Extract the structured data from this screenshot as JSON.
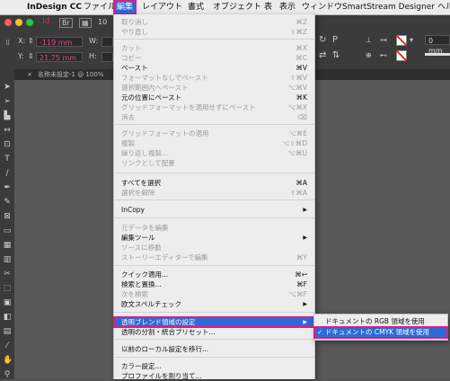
{
  "menubar": {
    "apple": "",
    "app": "InDesign CC",
    "items": [
      "ファイル",
      "編集",
      "レイアウト",
      "書式",
      "オブジェクト",
      "表",
      "表示",
      "ウィンドウ",
      "SmartStream Designer",
      "ヘル"
    ]
  },
  "toolbar": {
    "x_label": "X:",
    "x_value": "-119 mm",
    "y_label": "Y:",
    "y_value": "21.75 mm",
    "w_label": "W:",
    "h_label": "H:",
    "zoom_partial": "10",
    "stroke_value": "0 mm"
  },
  "document_tab": {
    "title": "名称未設定-1 @ 100%"
  },
  "edit_menu": {
    "items": [
      {
        "label": "取り消し",
        "shortcut": "⌘Z",
        "disabled": true
      },
      {
        "label": "やり直し",
        "shortcut": "⇧⌘Z",
        "disabled": true
      },
      {
        "label": "カット",
        "shortcut": "⌘X",
        "disabled": true
      },
      {
        "label": "コピー",
        "shortcut": "⌘C",
        "disabled": true
      },
      {
        "label": "ペースト",
        "shortcut": "⌘V",
        "disabled": false
      },
      {
        "label": "フォーマットなしでペースト",
        "shortcut": "⇧⌘V",
        "disabled": true
      },
      {
        "label": "選択範囲内へペースト",
        "shortcut": "⌥⌘V",
        "disabled": true
      },
      {
        "label": "元の位置にペースト",
        "shortcut": "⌘K",
        "disabled": false
      },
      {
        "label": "グリッドフォーマットを適用せずにペースト",
        "shortcut": "⌥⌘X",
        "disabled": true
      },
      {
        "label": "消去",
        "shortcut": "⌫",
        "disabled": true
      },
      {
        "label": "グリッドフォーマットの適用",
        "shortcut": "⌥⌘E",
        "disabled": true
      },
      {
        "label": "複製",
        "shortcut": "⌥⇧⌘D",
        "disabled": true
      },
      {
        "label": "繰り返し複製...",
        "shortcut": "⌥⌘U",
        "disabled": true
      },
      {
        "label": "リンクとして配置",
        "shortcut": "",
        "disabled": true
      },
      {
        "label": "すべてを選択",
        "shortcut": "⌘A",
        "disabled": false
      },
      {
        "label": "選択を解除",
        "shortcut": "⇧⌘A",
        "disabled": true
      },
      {
        "label": "InCopy",
        "shortcut": "",
        "disabled": false
      },
      {
        "label": "元データを編集",
        "shortcut": "",
        "disabled": true
      },
      {
        "label": "編集ツール",
        "shortcut": "",
        "disabled": false
      },
      {
        "label": "ソースに移動",
        "shortcut": "",
        "disabled": true
      },
      {
        "label": "ストーリーエディターで編集",
        "shortcut": "⌘Y",
        "disabled": true
      },
      {
        "label": "クイック適用...",
        "shortcut": "⌘↩",
        "disabled": false
      },
      {
        "label": "検索と置換...",
        "shortcut": "⌘F",
        "disabled": false
      },
      {
        "label": "次を検索",
        "shortcut": "⌥⌘F",
        "disabled": true
      },
      {
        "label": "欧文スペルチェック",
        "shortcut": "",
        "disabled": false
      },
      {
        "label": "透明ブレンド領域の設定",
        "shortcut": "",
        "disabled": false
      },
      {
        "label": "透明の分割・統合プリセット...",
        "shortcut": "",
        "disabled": false
      },
      {
        "label": "以前のローカル設定を移行...",
        "shortcut": "",
        "disabled": false
      },
      {
        "label": "カラー設定...",
        "shortcut": "",
        "disabled": false
      },
      {
        "label": "プロファイルを割り当て...",
        "shortcut": "",
        "disabled": false
      }
    ]
  },
  "submenu": {
    "items": [
      {
        "label": "ドキュメントの RGB 領域を使用",
        "checked": false
      },
      {
        "label": "ドキュメントの CMYK 領域を使用",
        "checked": true,
        "check_mark": "✓"
      }
    ]
  },
  "colors": {
    "highlight": "#2d6ad6",
    "annotation": "#e8197d"
  }
}
